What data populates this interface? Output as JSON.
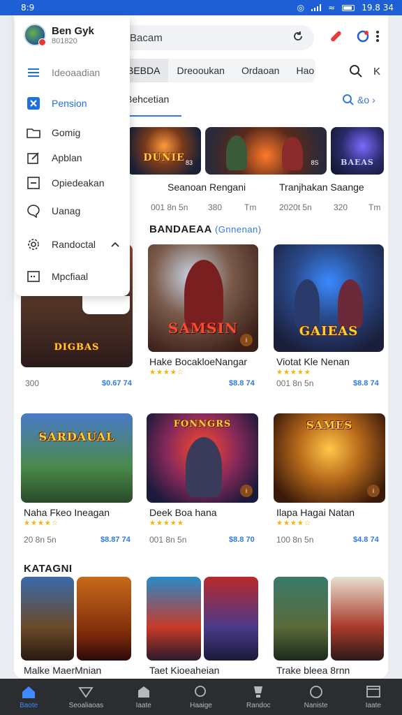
{
  "status": {
    "time": "8:9",
    "battery_text": "19.8 34"
  },
  "search": {
    "value": "Bacam"
  },
  "tabs": [
    {
      "label": "BEBDA"
    },
    {
      "label": "Dreooukan"
    },
    {
      "label": "Ordaoan"
    },
    {
      "label": "Hao"
    }
  ],
  "subtab": {
    "label": "Behcetian"
  },
  "more_link": {
    "label": "&o"
  },
  "drawer": {
    "profile_name": "Ben Gyk",
    "profile_sub": "801820",
    "items": [
      {
        "label": "Ideoaadian"
      },
      {
        "label": "Pension"
      },
      {
        "label": "Gomig"
      },
      {
        "label": "Apblan"
      },
      {
        "label": "Opiedeakan"
      },
      {
        "label": "Uanag"
      },
      {
        "label": "Randoctal"
      },
      {
        "label": "Mpcfiaal"
      }
    ]
  },
  "top_row": [
    {
      "tile_text": "DUNIE",
      "tile_badge": "83",
      "title": "Seanoan Rengani",
      "meta_left": "001 8n 5n",
      "meta_mid": "380",
      "meta_right": "Tm"
    },
    {
      "tile_text": "",
      "tile_badge": "8S",
      "title": "Tranjhakan Saange",
      "meta_left": "2020t 5n",
      "meta_mid": "320",
      "meta_right": "Tm"
    },
    {
      "tile_text": "BAEAS",
      "tile_badge": "",
      "title": "",
      "meta_left": "",
      "meta_mid": "",
      "meta_right": ""
    }
  ],
  "section1": {
    "title": "BANDAEAA",
    "sub": "(Gnnenan)"
  },
  "grid1": [
    {
      "tile_text": "DIGBAS",
      "title": "",
      "stars": "",
      "meta": "300",
      "price": "$0.67 74"
    },
    {
      "tile_text": "SAMSIN",
      "title": "Hake BocakloeNangar",
      "stars": "★★★★☆",
      "meta": "",
      "price": "$8.8 74"
    },
    {
      "tile_text": "GAIEAS",
      "title": "Viotat Kle Nenan",
      "stars": "★★★★★",
      "meta": "001 8n 5n",
      "price": "$8.8 74"
    }
  ],
  "grid2": [
    {
      "tile_text": "SARDAUAL",
      "title": "Naha Fkeo Ineagan",
      "stars": "★★★★☆",
      "meta": "20 8n 5n",
      "price": "$8.87 74"
    },
    {
      "tile_text": "FONNGRS",
      "title": "Deek Boa hana",
      "stars": "★★★★★",
      "meta": "001 8n 5n",
      "price": "$8.8 70"
    },
    {
      "tile_text": "SAMES",
      "title": "Ilapa Hagai Natan",
      "stars": "★★★★☆",
      "meta": "100 8n 5n",
      "price": "$4.8 74"
    }
  ],
  "section2": {
    "title": "KATAGNI"
  },
  "cats": [
    {
      "title": "Malke MaerMnian"
    },
    {
      "title": "Taet Kioeaheian"
    },
    {
      "title": "Trake bleea 8rnn"
    }
  ],
  "bottom_nav": [
    {
      "label": "Baote"
    },
    {
      "label": "Seoaliaoas"
    },
    {
      "label": "Iaate"
    },
    {
      "label": "Haaige"
    },
    {
      "label": "Randoc"
    },
    {
      "label": "Naniste"
    },
    {
      "label": "Iaate"
    }
  ]
}
